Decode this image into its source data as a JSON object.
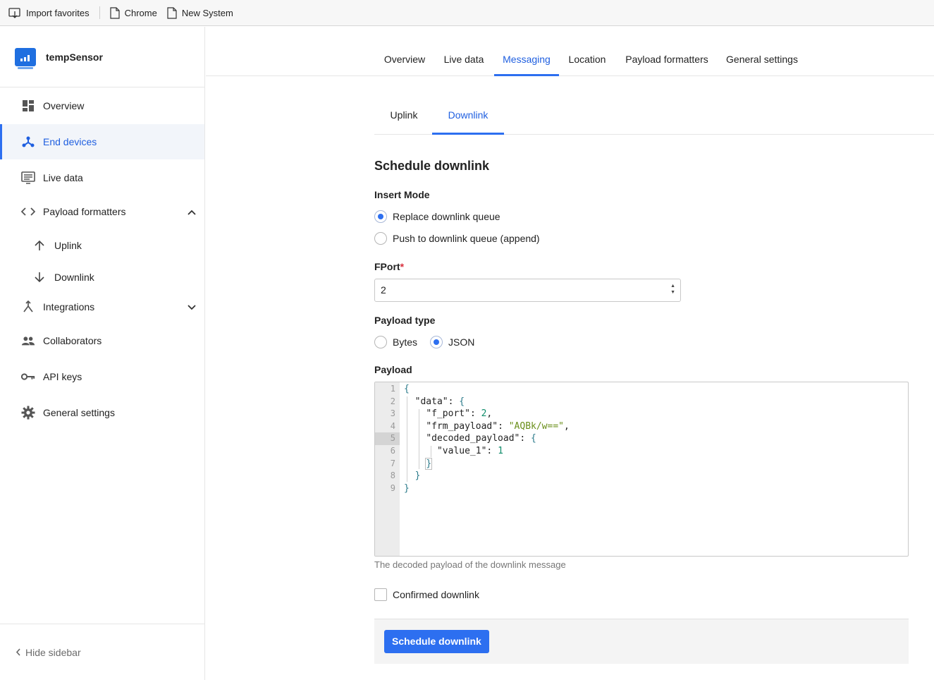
{
  "bookmarks": [
    {
      "label": "Import favorites",
      "icon": "import-favorites-icon"
    },
    {
      "label": "Chrome",
      "icon": "page-icon"
    },
    {
      "label": "New System",
      "icon": "page-icon"
    }
  ],
  "sidebar": {
    "app_name": "tempSensor",
    "items": [
      {
        "label": "Overview",
        "icon": "dashboard-icon"
      },
      {
        "label": "End devices",
        "icon": "devices-icon",
        "active": true
      },
      {
        "label": "Live data",
        "icon": "live-data-icon"
      },
      {
        "label": "Payload formatters",
        "icon": "code-icon",
        "expanded": true
      },
      {
        "label": "Uplink",
        "icon": "arrow-up-icon"
      },
      {
        "label": "Downlink",
        "icon": "arrow-down-icon"
      },
      {
        "label": "Integrations",
        "icon": "integrations-icon",
        "expanded": false
      },
      {
        "label": "Collaborators",
        "icon": "people-icon"
      },
      {
        "label": "API keys",
        "icon": "key-icon"
      },
      {
        "label": "General settings",
        "icon": "gear-icon"
      }
    ],
    "hide_label": "Hide sidebar"
  },
  "tabs": [
    {
      "label": "Overview"
    },
    {
      "label": "Live data"
    },
    {
      "label": "Messaging",
      "active": true
    },
    {
      "label": "Location"
    },
    {
      "label": "Payload formatters"
    },
    {
      "label": "General settings"
    }
  ],
  "subtabs": [
    {
      "label": "Uplink"
    },
    {
      "label": "Downlink",
      "active": true
    }
  ],
  "form": {
    "title": "Schedule downlink",
    "insert_mode_label": "Insert Mode",
    "insert_modes": [
      {
        "label": "Replace downlink queue",
        "selected": true
      },
      {
        "label": "Push to downlink queue (append)",
        "selected": false
      }
    ],
    "fport_label": "FPort",
    "fport_required": "*",
    "fport_value": "2",
    "payload_type_label": "Payload type",
    "payload_types": [
      {
        "label": "Bytes",
        "selected": false
      },
      {
        "label": "JSON",
        "selected": true
      }
    ],
    "payload_label": "Payload",
    "payload_help": "The decoded payload of the downlink message",
    "line_numbers": [
      "1",
      "2",
      "3",
      "4",
      "5",
      "6",
      "7",
      "8",
      "9"
    ],
    "highlighted_line": 5,
    "code": {
      "open": "{",
      "data_key": "\"data\"",
      "fport_key": "\"f_port\"",
      "fport_val": "2",
      "frm_key": "\"frm_payload\"",
      "frm_val": "\"AQBk/w==\"",
      "decoded_key": "\"decoded_payload\"",
      "value_key": "\"value_1\"",
      "value_val": "1",
      "close": "}"
    },
    "confirmed_label": "Confirmed downlink",
    "confirmed_checked": false,
    "submit_label": "Schedule downlink"
  },
  "colors": {
    "accent": "#2d6ff0",
    "active_text": "#1f5fe0",
    "required": "#d9303d"
  }
}
